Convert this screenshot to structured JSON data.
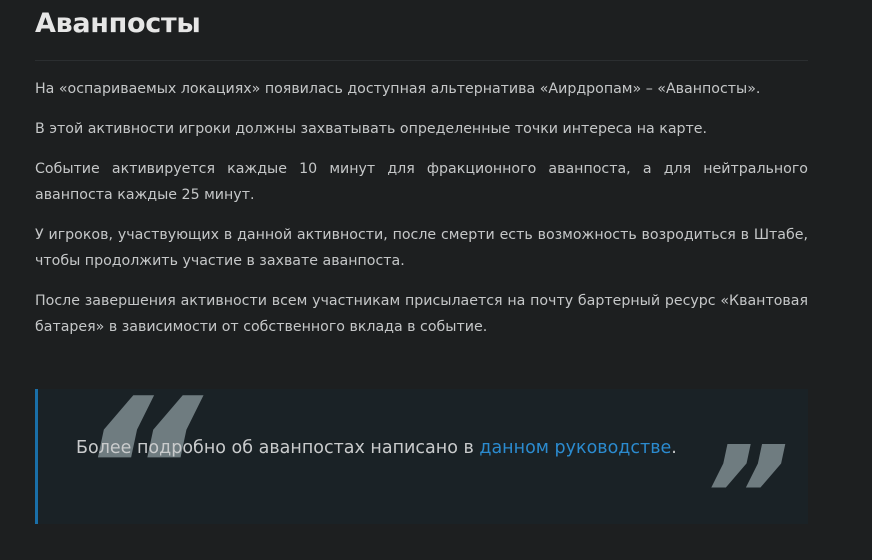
{
  "article": {
    "title": "Аванпосты",
    "paragraphs": [
      "На «оспариваемых локациях» появилась доступная альтернатива «Аирдропам» – «Аванпосты».",
      "В этой активности игроки должны захватывать определенные точки интереса на карте.",
      "Событие активируется каждые 10 минут для фракционного аванпоста, а для нейтрального аванпоста каждые 25 минут.",
      "У игроков, участвующих в данной активности, после смерти есть возможность возродиться в Штабе, чтобы продолжить участие в захвате аванпоста.",
      "После завершения активности всем участникам присылается на почту бартерный ресурс «Квантовая батарея» в зависимости от собственного вклада в событие."
    ]
  },
  "quote": {
    "open_mark": "“",
    "close_mark": "”",
    "text_before": "Более подробно об аванпостах написано в ",
    "link_text": "данном руководстве",
    "text_after": "."
  },
  "colors": {
    "background": "#1d1f20",
    "quote_background": "#1a2226",
    "quote_border": "#1a6fa8",
    "link": "#2b8bcf",
    "quote_marks": "#6f7c80"
  }
}
